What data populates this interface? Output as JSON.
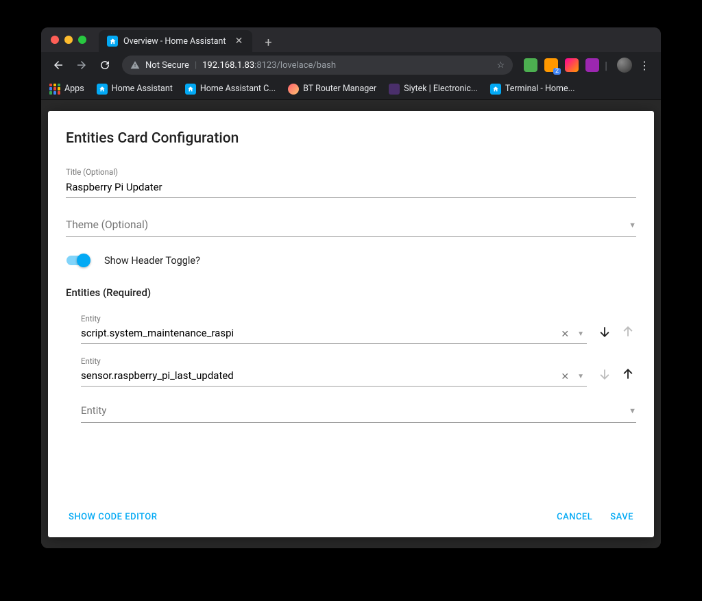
{
  "browser": {
    "tab_title": "Overview - Home Assistant",
    "not_secure_label": "Not Secure",
    "url_host": "192.168.1.83",
    "url_port": ":8123",
    "url_path": "/lovelace/bash",
    "apps_label": "Apps",
    "bookmarks": [
      {
        "label": "Home Assistant"
      },
      {
        "label": "Home Assistant C..."
      },
      {
        "label": "BT Router Manager"
      },
      {
        "label": "Siytek | Electronic..."
      },
      {
        "label": "Terminal - Home..."
      }
    ],
    "rss_badge": "2"
  },
  "modal": {
    "title": "Entities Card Configuration",
    "title_field_label": "Title (Optional)",
    "title_field_value": "Raspberry Pi Updater",
    "theme_field_placeholder": "Theme (Optional)",
    "toggle_label": "Show Header Toggle?",
    "toggle_on": true,
    "entities_section_label": "Entities (Required)",
    "entity_field_label": "Entity",
    "entities": [
      {
        "value": "script.system_maintenance_raspi",
        "down_enabled": true,
        "up_enabled": false
      },
      {
        "value": "sensor.raspberry_pi_last_updated",
        "down_enabled": false,
        "up_enabled": true
      }
    ],
    "add_entity_placeholder": "Entity",
    "show_code_editor_label": "Show Code Editor",
    "cancel_label": "Cancel",
    "save_label": "Save"
  }
}
